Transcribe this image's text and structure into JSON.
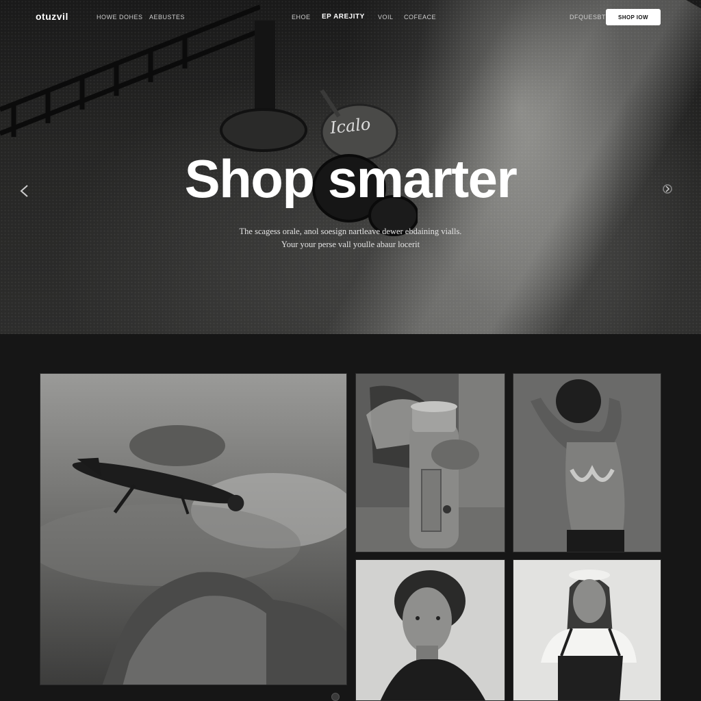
{
  "nav": {
    "logo": "otuzvil",
    "left_links": [
      "HOWE DOHES",
      "AEBUSTES"
    ],
    "center_links": [
      "EHOE",
      "EP AREJITY",
      "VOIL",
      "COFEACE"
    ],
    "right_link": "DFQUESBT",
    "cta_label": "SHOP IOW"
  },
  "hero": {
    "script_text": "Icalo",
    "headline": "Shop smarter",
    "subline_1": "The scagess orale, anol soesign nartleave dewer ebdaining vialls.",
    "subline_2": "Your your perse vall youlle abaur locerit"
  },
  "icons": {
    "left_arrow": "chevron-left-icon",
    "right_arrow": "chevron-right-icon"
  },
  "gallery": {
    "tiles": [
      "underwater-vehicle-photo",
      "hydrant-photo",
      "dancer-photo",
      "woman-portrait-photo",
      "apron-woman-photo"
    ]
  },
  "colors": {
    "background": "#161616",
    "button_bg": "#ffffff",
    "text": "#ffffff"
  }
}
